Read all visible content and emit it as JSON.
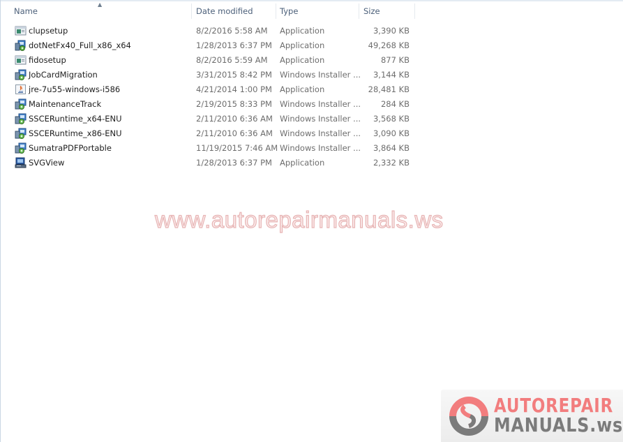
{
  "header": {
    "columns": {
      "name": "Name",
      "date": "Date modified",
      "type": "Type",
      "size": "Size"
    },
    "sort_indicator": "▲"
  },
  "files": [
    {
      "name": "clupsetup",
      "date": "8/2/2016 5:58 AM",
      "type": "Application",
      "size": "3,390 KB",
      "icon": "application-window-icon"
    },
    {
      "name": "dotNetFx40_Full_x86_x64",
      "date": "1/28/2013 6:37 PM",
      "type": "Application",
      "size": "49,268 KB",
      "icon": "installer-icon"
    },
    {
      "name": "fidosetup",
      "date": "8/2/2016 5:59 AM",
      "type": "Application",
      "size": "877 KB",
      "icon": "application-window-icon"
    },
    {
      "name": "JobCardMigration",
      "date": "3/31/2015 8:42 PM",
      "type": "Windows Installer ...",
      "size": "3,144 KB",
      "icon": "msi-installer-icon"
    },
    {
      "name": "jre-7u55-windows-i586",
      "date": "4/21/2014 1:00 PM",
      "type": "Application",
      "size": "28,481 KB",
      "icon": "java-icon"
    },
    {
      "name": "MaintenanceTrack",
      "date": "2/19/2015 8:33 PM",
      "type": "Windows Installer ...",
      "size": "284 KB",
      "icon": "msi-installer-icon"
    },
    {
      "name": "SSCERuntime_x64-ENU",
      "date": "2/11/2010 6:36 AM",
      "type": "Windows Installer ...",
      "size": "3,568 KB",
      "icon": "msi-installer-icon"
    },
    {
      "name": "SSCERuntime_x86-ENU",
      "date": "2/11/2010 6:36 AM",
      "type": "Windows Installer ...",
      "size": "3,090 KB",
      "icon": "msi-installer-icon"
    },
    {
      "name": "SumatraPDFPortable",
      "date": "11/19/2015 7:46 AM",
      "type": "Windows Installer ...",
      "size": "3,864 KB",
      "icon": "msi-installer-icon"
    },
    {
      "name": "SVGView",
      "date": "1/28/2013 6:37 PM",
      "type": "Application",
      "size": "2,332 KB",
      "icon": "setup-computer-icon"
    }
  ],
  "watermark": {
    "text": "www.autorepairmanuals.ws"
  },
  "logo": {
    "line1": "AUTOREPAIR",
    "line2": "MANUALS",
    "suffix": ".ws",
    "colors": {
      "red": "#f27d7e",
      "gray": "#7b7b7b"
    }
  }
}
